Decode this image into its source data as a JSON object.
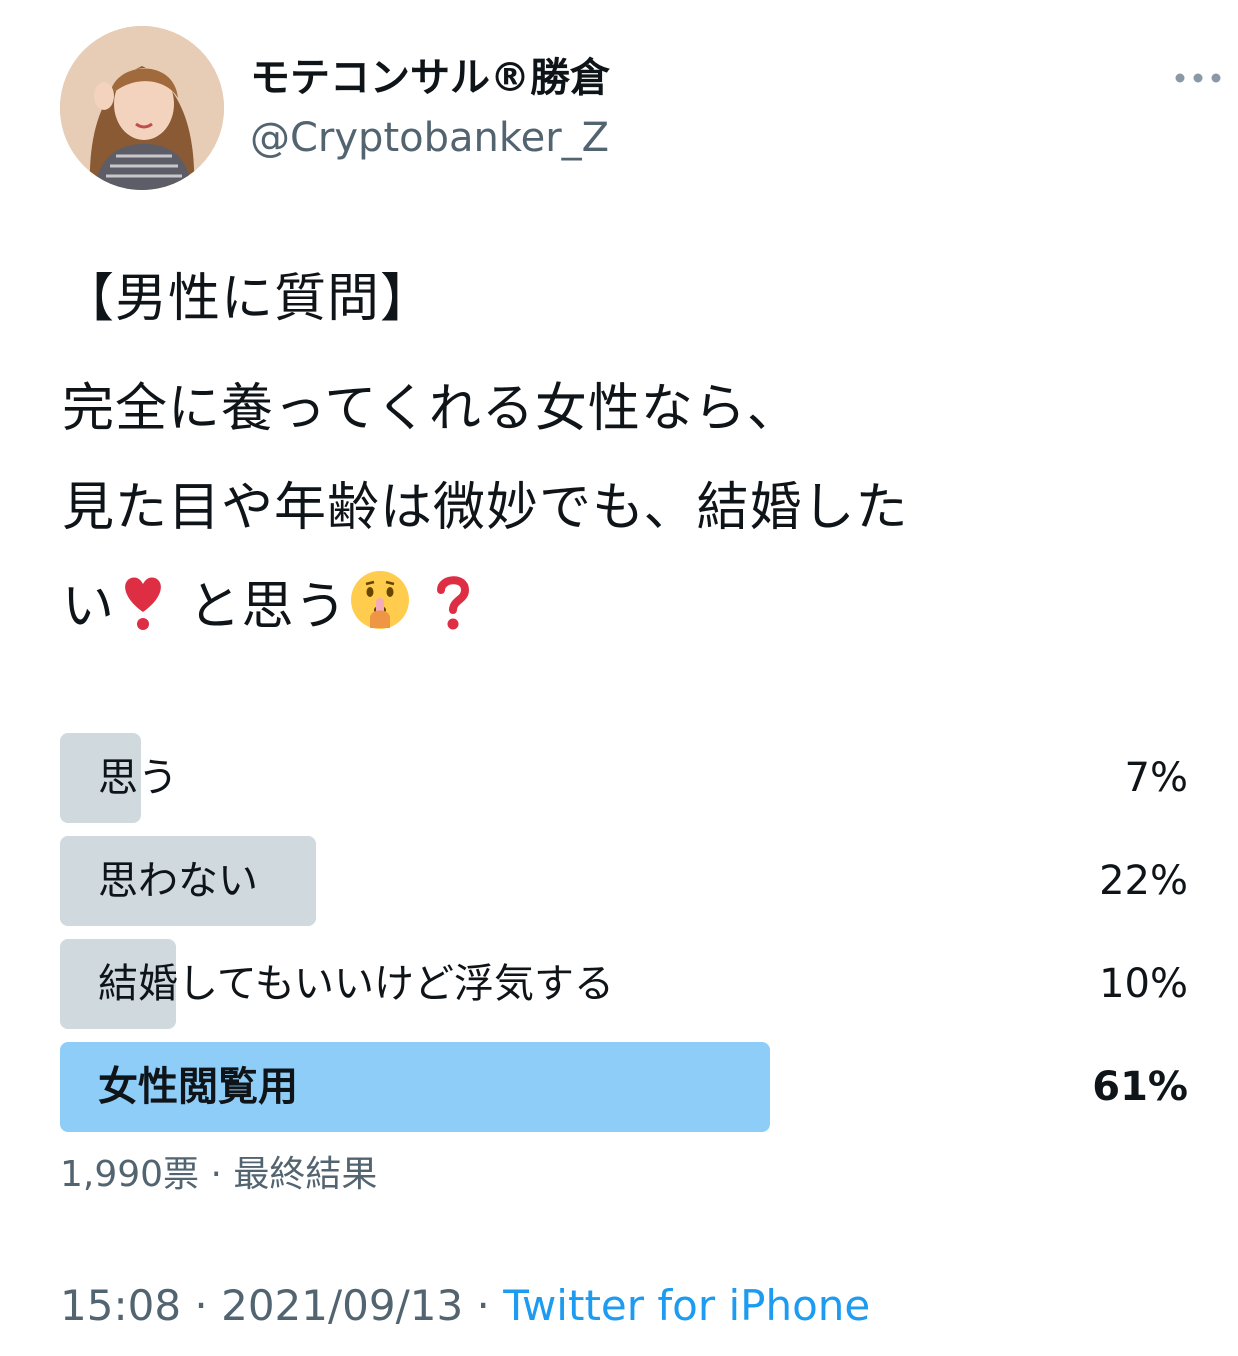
{
  "author": {
    "display_name": "モテコンサル®勝倉",
    "handle": "@Cryptobanker_Z"
  },
  "tweet": {
    "line1": "【男性に質問】",
    "line2": "完全に養ってくれる女性なら、",
    "line3": "見た目や年齢は微妙でも、結婚した",
    "line4_a": "い",
    "line4_b": "と思う",
    "emojis": [
      "heavy-heart-exclamation",
      "shushing-face",
      "red-question-mark"
    ]
  },
  "poll": {
    "options": [
      {
        "label": "思う",
        "percent_text": "7%",
        "percent": 7
      },
      {
        "label": "思わない",
        "percent_text": "22%",
        "percent": 22
      },
      {
        "label": "結婚してもいいけど浮気する",
        "percent_text": "10%",
        "percent": 10
      },
      {
        "label": "女性閲覧用",
        "percent_text": "61%",
        "percent": 61
      }
    ],
    "votes_text": "1,990票",
    "separator": " · ",
    "status_text": "最終結果"
  },
  "footer": {
    "time": "15:08",
    "date": "2021/09/13",
    "separator": " · ",
    "source": "Twitter for iPhone"
  },
  "colors": {
    "text": "#0f1419",
    "secondary": "#536471",
    "link": "#1d9bf0",
    "bar": "#cfd9de",
    "winner_bar": "#8ecdf8"
  }
}
